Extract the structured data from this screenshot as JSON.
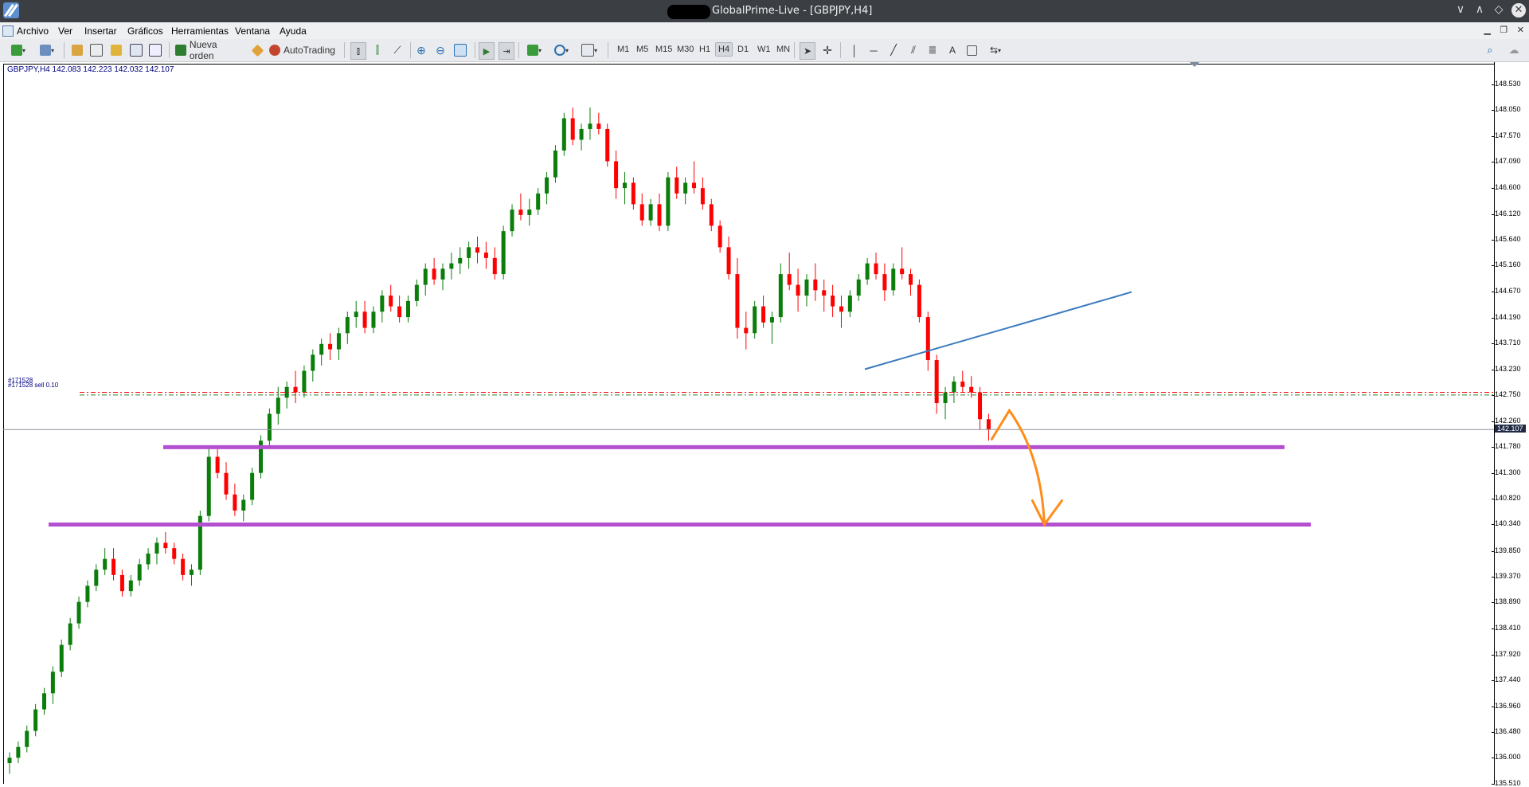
{
  "window": {
    "title": "GlobalPrime-Live - [GBPJPY,H4]",
    "controls": [
      "∨",
      "∧",
      "◇",
      "✕"
    ]
  },
  "menu": {
    "items": [
      "Archivo",
      "Ver",
      "Insertar",
      "Gráficos",
      "Herramientas",
      "Ventana",
      "Ayuda"
    ]
  },
  "toolbar": {
    "new_order_label": "Nueva orden",
    "autotrading_label": "AutoTrading",
    "timeframes": [
      "M1",
      "M5",
      "M15",
      "M30",
      "H1",
      "H4",
      "D1",
      "W1",
      "MN"
    ],
    "active_timeframe": "H4",
    "text_tool": "A"
  },
  "chart": {
    "info": "GBPJPY,H4  142.083 142.223 142.032 142.107",
    "bid_price": "142.107",
    "order_label_1": "#171528",
    "order_label_2": "#171528 sell 0.10",
    "colors": {
      "bull": "#0a7d0a",
      "bear": "#ff0000",
      "support": "#b44fd0",
      "trendline": "#3a7abf",
      "projection": "#ff8c1a",
      "order_line": "#ff0000"
    }
  },
  "price_axis": {
    "labels": [
      "148.530",
      "148.050",
      "147.570",
      "147.090",
      "146.600",
      "146.120",
      "145.640",
      "145.160",
      "144.670",
      "144.190",
      "143.710",
      "143.230",
      "142.750",
      "142.260",
      "141.780",
      "141.300",
      "140.820",
      "140.340",
      "139.850",
      "139.370",
      "138.890",
      "138.410",
      "137.920",
      "137.440",
      "136.960",
      "136.480",
      "136.000",
      "135.510"
    ]
  },
  "chart_data": {
    "type": "candlestick",
    "symbol": "GBPJPY",
    "timeframe": "H4",
    "ylim": [
      135.5,
      148.9
    ],
    "current": {
      "open": 142.083,
      "high": 142.223,
      "low": 142.032,
      "close": 142.107
    },
    "support_levels": [
      141.78,
      140.34
    ],
    "order_levels": [
      142.8,
      142.75
    ],
    "trendline": [
      143.23,
      144.4
    ],
    "candles": [
      [
        135.9,
        136.1,
        135.7,
        136.0
      ],
      [
        136.0,
        136.3,
        135.9,
        136.2
      ],
      [
        136.2,
        136.6,
        136.1,
        136.5
      ],
      [
        136.5,
        137.0,
        136.4,
        136.9
      ],
      [
        136.9,
        137.3,
        136.8,
        137.2
      ],
      [
        137.2,
        137.7,
        137.0,
        137.6
      ],
      [
        137.6,
        138.2,
        137.5,
        138.1
      ],
      [
        138.1,
        138.6,
        138.0,
        138.5
      ],
      [
        138.5,
        139.0,
        138.4,
        138.9
      ],
      [
        138.9,
        139.3,
        138.8,
        139.2
      ],
      [
        139.2,
        139.6,
        139.1,
        139.5
      ],
      [
        139.5,
        139.9,
        139.4,
        139.7
      ],
      [
        139.7,
        139.9,
        139.3,
        139.4
      ],
      [
        139.4,
        139.5,
        139.0,
        139.1
      ],
      [
        139.1,
        139.4,
        139.0,
        139.3
      ],
      [
        139.3,
        139.7,
        139.2,
        139.6
      ],
      [
        139.6,
        139.9,
        139.5,
        139.8
      ],
      [
        139.8,
        140.1,
        139.6,
        140.0
      ],
      [
        140.0,
        140.2,
        139.8,
        139.9
      ],
      [
        139.9,
        140.0,
        139.6,
        139.7
      ],
      [
        139.7,
        139.8,
        139.3,
        139.4
      ],
      [
        139.4,
        139.6,
        139.2,
        139.5
      ],
      [
        139.5,
        140.6,
        139.4,
        140.5
      ],
      [
        140.5,
        141.8,
        140.4,
        141.6
      ],
      [
        141.6,
        141.8,
        141.2,
        141.3
      ],
      [
        141.3,
        141.5,
        140.8,
        140.9
      ],
      [
        140.9,
        141.1,
        140.5,
        140.6
      ],
      [
        140.6,
        140.9,
        140.4,
        140.8
      ],
      [
        140.8,
        141.4,
        140.7,
        141.3
      ],
      [
        141.3,
        142.0,
        141.2,
        141.9
      ],
      [
        141.9,
        142.5,
        141.8,
        142.4
      ],
      [
        142.4,
        142.9,
        142.2,
        142.7
      ],
      [
        142.7,
        143.0,
        142.5,
        142.9
      ],
      [
        142.9,
        143.2,
        142.6,
        142.8
      ],
      [
        142.8,
        143.3,
        142.7,
        143.2
      ],
      [
        143.2,
        143.6,
        143.0,
        143.5
      ],
      [
        143.5,
        143.8,
        143.3,
        143.7
      ],
      [
        143.7,
        143.9,
        143.4,
        143.6
      ],
      [
        143.6,
        144.0,
        143.4,
        143.9
      ],
      [
        143.9,
        144.3,
        143.7,
        144.2
      ],
      [
        144.2,
        144.5,
        144.0,
        144.3
      ],
      [
        144.3,
        144.5,
        143.9,
        144.0
      ],
      [
        144.0,
        144.4,
        143.9,
        144.3
      ],
      [
        144.3,
        144.7,
        144.1,
        144.6
      ],
      [
        144.6,
        144.8,
        144.3,
        144.4
      ],
      [
        144.4,
        144.6,
        144.1,
        144.2
      ],
      [
        144.2,
        144.6,
        144.1,
        144.5
      ],
      [
        144.5,
        144.9,
        144.4,
        144.8
      ],
      [
        144.8,
        145.2,
        144.6,
        145.1
      ],
      [
        145.1,
        145.3,
        144.8,
        144.9
      ],
      [
        144.9,
        145.2,
        144.7,
        145.1
      ],
      [
        145.1,
        145.4,
        144.9,
        145.2
      ],
      [
        145.2,
        145.5,
        145.0,
        145.3
      ],
      [
        145.3,
        145.6,
        145.1,
        145.5
      ],
      [
        145.5,
        145.7,
        145.2,
        145.4
      ],
      [
        145.4,
        145.6,
        145.1,
        145.3
      ],
      [
        145.3,
        145.5,
        144.9,
        145.0
      ],
      [
        145.0,
        145.9,
        144.9,
        145.8
      ],
      [
        145.8,
        146.3,
        145.7,
        146.2
      ],
      [
        146.2,
        146.5,
        146.0,
        146.1
      ],
      [
        146.1,
        146.4,
        145.9,
        146.2
      ],
      [
        146.2,
        146.6,
        146.1,
        146.5
      ],
      [
        146.5,
        146.9,
        146.3,
        146.8
      ],
      [
        146.8,
        147.4,
        146.7,
        147.3
      ],
      [
        147.3,
        148.0,
        147.2,
        147.9
      ],
      [
        147.9,
        148.1,
        147.4,
        147.5
      ],
      [
        147.5,
        147.8,
        147.3,
        147.7
      ],
      [
        147.7,
        148.1,
        147.5,
        147.8
      ],
      [
        147.8,
        148.0,
        147.6,
        147.7
      ],
      [
        147.7,
        147.8,
        147.0,
        147.1
      ],
      [
        147.1,
        147.3,
        146.4,
        146.6
      ],
      [
        146.6,
        146.9,
        146.3,
        146.7
      ],
      [
        146.7,
        146.8,
        146.2,
        146.3
      ],
      [
        146.3,
        146.5,
        145.9,
        146.0
      ],
      [
        146.0,
        146.4,
        145.9,
        146.3
      ],
      [
        146.3,
        146.5,
        145.8,
        145.9
      ],
      [
        145.9,
        146.9,
        145.8,
        146.8
      ],
      [
        146.8,
        147.0,
        146.4,
        146.5
      ],
      [
        146.5,
        146.8,
        146.3,
        146.7
      ],
      [
        146.7,
        147.1,
        146.5,
        146.6
      ],
      [
        146.6,
        146.8,
        146.2,
        146.3
      ],
      [
        146.3,
        146.4,
        145.8,
        145.9
      ],
      [
        145.9,
        146.0,
        145.4,
        145.5
      ],
      [
        145.5,
        145.7,
        144.9,
        145.0
      ],
      [
        145.0,
        145.3,
        143.8,
        144.0
      ],
      [
        144.0,
        144.3,
        143.6,
        143.9
      ],
      [
        143.9,
        144.5,
        143.8,
        144.4
      ],
      [
        144.4,
        144.6,
        144.0,
        144.1
      ],
      [
        144.1,
        144.3,
        143.7,
        144.2
      ],
      [
        144.2,
        145.2,
        144.1,
        145.0
      ],
      [
        145.0,
        145.4,
        144.7,
        144.8
      ],
      [
        144.8,
        145.1,
        144.3,
        144.6
      ],
      [
        144.6,
        145.0,
        144.4,
        144.9
      ],
      [
        144.9,
        145.2,
        144.5,
        144.7
      ],
      [
        144.7,
        144.9,
        144.3,
        144.6
      ],
      [
        144.6,
        144.8,
        144.2,
        144.4
      ],
      [
        144.4,
        144.6,
        144.0,
        144.3
      ],
      [
        144.3,
        144.7,
        144.2,
        144.6
      ],
      [
        144.6,
        145.0,
        144.5,
        144.9
      ],
      [
        144.9,
        145.3,
        144.8,
        145.2
      ],
      [
        145.2,
        145.4,
        144.9,
        145.0
      ],
      [
        145.0,
        145.2,
        144.5,
        144.7
      ],
      [
        144.7,
        145.2,
        144.6,
        145.1
      ],
      [
        145.1,
        145.5,
        144.9,
        145.0
      ],
      [
        145.0,
        145.1,
        144.6,
        144.8
      ],
      [
        144.8,
        144.9,
        144.1,
        144.2
      ],
      [
        144.2,
        144.3,
        143.2,
        143.4
      ],
      [
        143.4,
        143.5,
        142.4,
        142.6
      ],
      [
        142.6,
        142.9,
        142.3,
        142.8
      ],
      [
        142.8,
        143.1,
        142.6,
        143.0
      ],
      [
        143.0,
        143.2,
        142.8,
        142.9
      ],
      [
        142.9,
        143.1,
        142.7,
        142.8
      ],
      [
        142.8,
        142.9,
        142.1,
        142.3
      ],
      [
        142.3,
        142.4,
        141.9,
        142.107
      ]
    ]
  }
}
